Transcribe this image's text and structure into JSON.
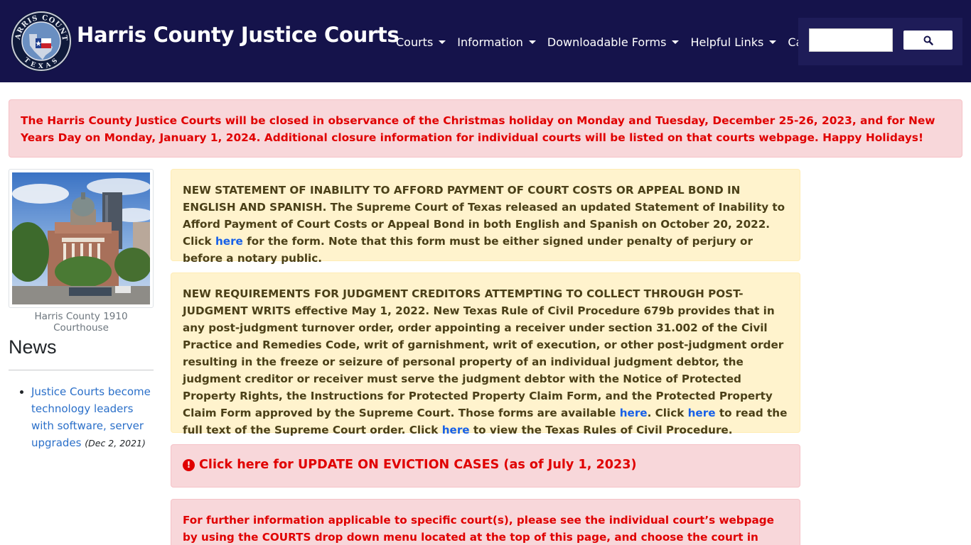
{
  "header": {
    "logo": {
      "icon": "harris-county-seal-icon",
      "text_top": "HARRIS COUNTY",
      "text_bottom": "TEXAS"
    },
    "brand": "Harris County Justice Courts",
    "nav": [
      {
        "label": "Courts",
        "dropdown": true
      },
      {
        "label": "Information",
        "dropdown": true
      },
      {
        "label": "Downloadable Forms",
        "dropdown": true
      },
      {
        "label": "Helpful Links",
        "dropdown": true
      },
      {
        "label": "Careers",
        "dropdown": false
      }
    ],
    "search": {
      "placeholder": "",
      "button_icon": "search-icon"
    }
  },
  "holiday_alert": "The Harris County Justice Courts will be closed in observance of the Christmas holiday on Monday and Tuesday, December 25-26, 2023, and for New Years Day on Monday, January 1, 2024. Additional closure information for individual courts will be listed on that courts webpage. Happy Holidays!",
  "sidebar": {
    "photo_caption": "Harris County 1910 Courthouse",
    "news_title": "News",
    "news_items": [
      {
        "link": "Justice Courts become technology leaders with software, server upgrades",
        "date": "(Dec 2, 2021)"
      }
    ]
  },
  "notices": {
    "inability": {
      "before": "NEW STATEMENT OF INABILITY TO AFFORD PAYMENT OF COURT COSTS OR APPEAL BOND IN ENGLISH AND SPANISH. The Supreme Court of Texas released an updated Statement of Inability to Afford Payment of Court Costs or Appeal Bond in both English and Spanish on October 20, 2022. Click ",
      "link": "here",
      "after": " for the form. Note that this form must be either signed under penalty of perjury or before a notary public."
    },
    "judgment": {
      "part1": "NEW REQUIREMENTS FOR JUDGMENT CREDITORS ATTEMPTING TO COLLECT THROUGH POST-JUDGMENT WRITS effective May 1, 2022. New Texas Rule of Civil Procedure 679b provides that in any post-judgment turnover order, order appointing a receiver under section 31.002 of the Civil Practice and Remedies Code, writ of garnishment, writ of execution, or other post-judgment order resulting in the freeze or seizure of personal property of an individual judgment debtor, the judgment creditor or receiver must serve the judgment debtor with the Notice of Protected Property Rights, the Instructions for Protected Property Claim Form, and the Protected Property Claim Form approved by the Supreme Court. Those forms are available ",
      "link1": "here",
      "part2": ". Click ",
      "link2": "here",
      "part3": " to read the full text of the Supreme Court order. Click ",
      "link3": "here",
      "part4": " to view the Texas Rules of Civil Procedure."
    },
    "eviction": {
      "icon": "exclamation-circle-icon",
      "label": "Click here for UPDATE ON EVICTION CASES (as of July 1, 2023)"
    },
    "further_info": "For further information applicable to specific court(s), please see the individual court’s webpage by using the COURTS drop down menu located at the top of this page, and choose the court in which you are interested."
  },
  "colors": {
    "navbar": "#15134b",
    "alert_red": "#e00000",
    "link_blue": "#1760e8",
    "warning_bg": "#fff3cd",
    "danger_bg": "#f8d7da"
  }
}
